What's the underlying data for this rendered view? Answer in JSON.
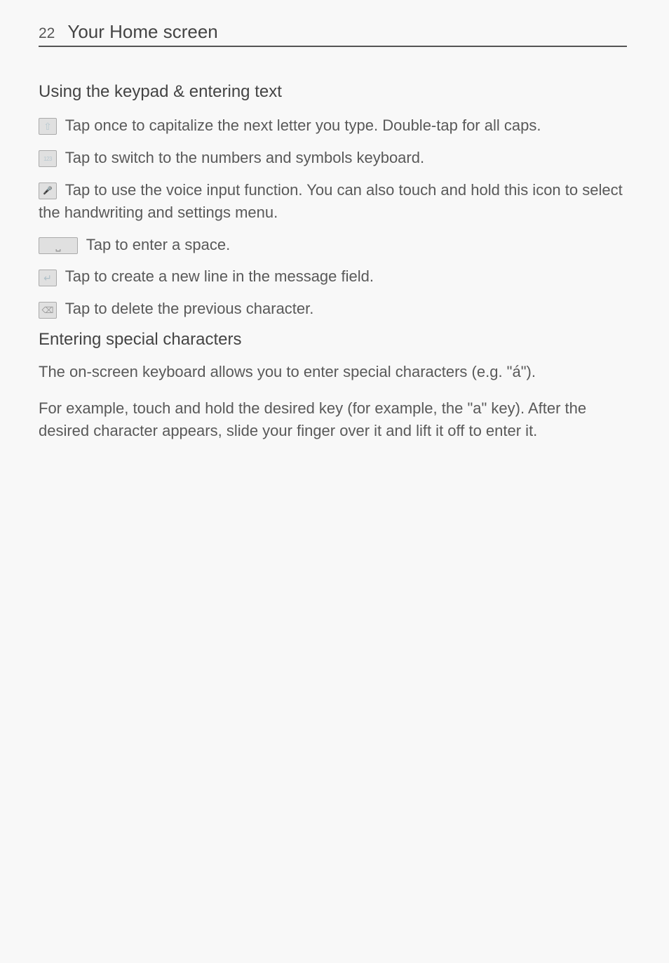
{
  "header": {
    "page_number": "22",
    "chapter_title": "Your Home screen"
  },
  "section1": {
    "heading": "Using the keypad & entering text",
    "items": [
      {
        "text": "Tap once to capitalize the next letter you type. Double-tap for all caps."
      },
      {
        "text": "Tap to switch to the numbers and symbols keyboard."
      },
      {
        "text": "Tap to use the voice input function. You can also touch and hold this icon to select the handwriting and settings menu."
      },
      {
        "text": "Tap to enter a space."
      },
      {
        "text": "Tap to create a new line in the message field."
      },
      {
        "text": "Tap to delete the previous character."
      }
    ]
  },
  "section2": {
    "heading": "Entering special characters",
    "paragraphs": [
      "The on-screen keyboard allows you to enter special characters (e.g. \"á\").",
      "For example, touch and hold the desired key (for example, the \"a\" key). After the desired character appears, slide your finger over it and lift it off to enter it."
    ]
  }
}
